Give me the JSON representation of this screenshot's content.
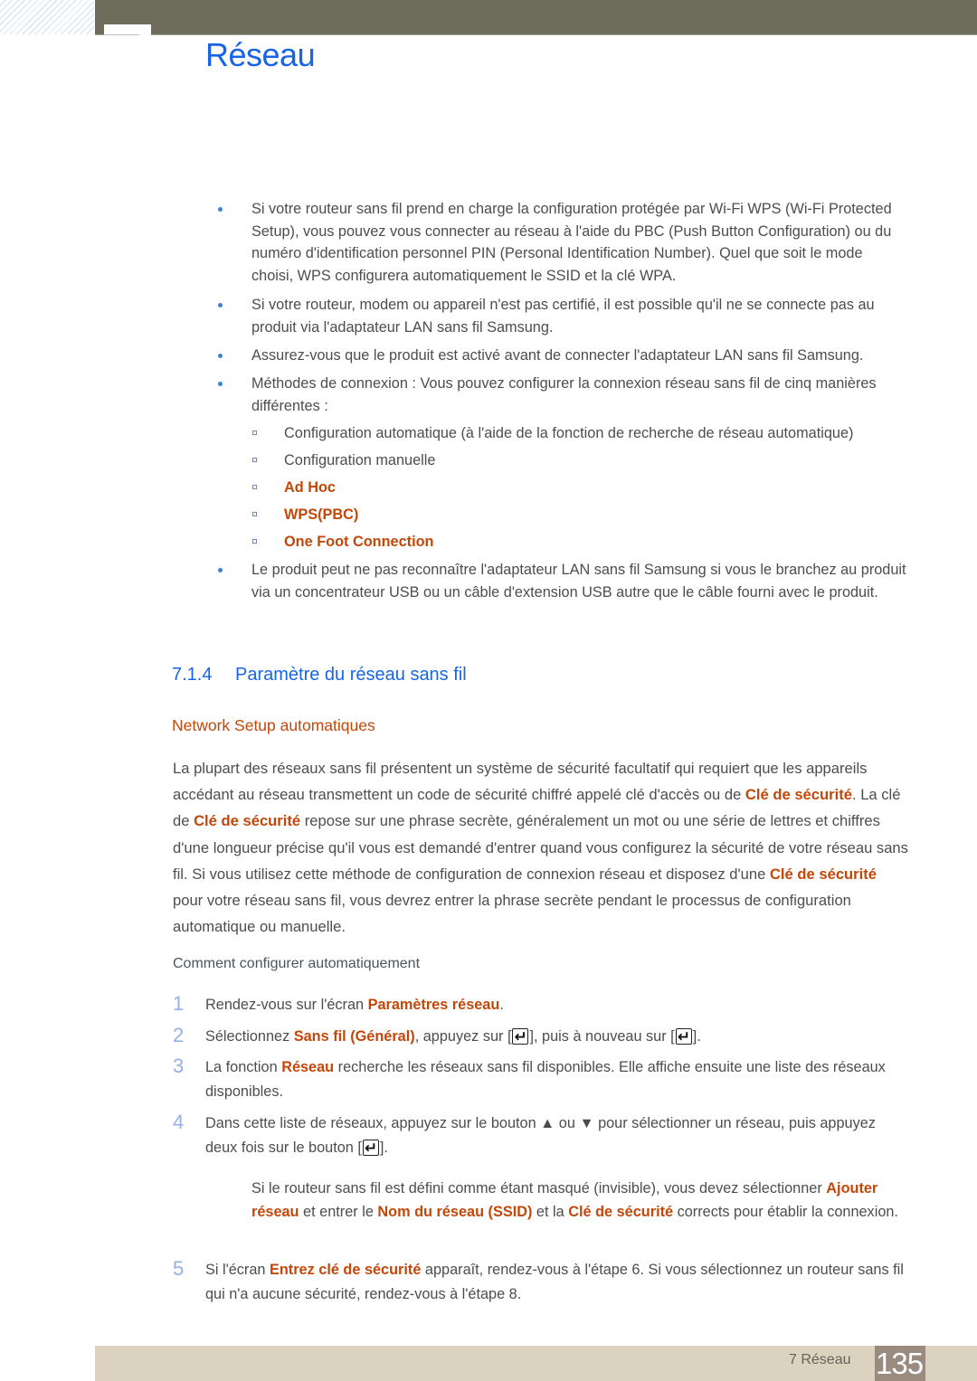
{
  "header": {
    "chapter_title": "Réseau"
  },
  "bullets": [
    "Si votre routeur sans fil prend en charge la configuration protégée par Wi-Fi WPS (Wi-Fi Protected Setup), vous pouvez vous connecter au réseau à l'aide du PBC (Push Button Configuration) ou du numéro d'identification personnel PIN (Personal Identification Number). Quel que soit le mode choisi, WPS configurera automatiquement le SSID et la clé WPA.",
    "Si votre routeur, modem ou appareil n'est pas certifié, il est possible qu'il ne se connecte pas au produit via l'adaptateur LAN sans fil Samsung.",
    "Assurez-vous que le produit est activé avant de connecter l'adaptateur LAN sans fil Samsung.",
    "Méthodes de connexion : Vous pouvez configurer la connexion réseau sans fil de cinq manières différentes :",
    "Le produit peut ne pas reconnaître l'adaptateur LAN sans fil Samsung si vous le branchez au produit via un concentrateur USB ou un câble d'extension USB autre que le câble fourni avec le produit."
  ],
  "connection_methods": [
    {
      "label": "Configuration automatique (à l'aide de la fonction de recherche de réseau automatique)",
      "highlight": false
    },
    {
      "label": "Configuration manuelle",
      "highlight": false
    },
    {
      "label": "Ad Hoc",
      "highlight": true
    },
    {
      "label": "WPS(PBC)",
      "highlight": true
    },
    {
      "label": "One Foot Connection",
      "highlight": true
    }
  ],
  "section": {
    "number": "7.1.4",
    "title": "Paramètre du réseau sans fil"
  },
  "subsection": {
    "title": "Network Setup automatiques"
  },
  "intro": {
    "p1": "La plupart des réseaux sans fil présentent un système de sécurité facultatif qui requiert que les appareils accédant au réseau transmettent un code de sécurité chiffré appelé clé d'accès ou de ",
    "key1": "Clé de sécurité",
    "p2": ". La clé de ",
    "key2": "Clé de sécurité",
    "p3": " repose sur une phrase secrète, généralement un mot ou une série de lettres et chiffres d'une longueur précise qu'il vous est demandé d'entrer quand vous configurez la sécurité de votre réseau sans fil. Si vous utilisez cette méthode de configuration de connexion réseau et disposez d'une ",
    "key3": "Clé de sécurité",
    "p4": " pour votre réseau sans fil, vous devrez entrer la phrase secrète pendant le processus de configuration automatique ou manuelle."
  },
  "howto": {
    "title": "Comment configurer automatiquement"
  },
  "steps": [
    {
      "num": "1",
      "t1": "Rendez-vous sur l'écran ",
      "h1": "Paramètres réseau",
      "t2": "."
    },
    {
      "num": "2",
      "t1": "Sélectionnez ",
      "h1": "Sans fil (Général)",
      "t2": ", appuyez sur [",
      "t3": "], puis à nouveau sur [",
      "t4": "]."
    },
    {
      "num": "3",
      "t1": "La fonction ",
      "h1": "Réseau",
      "t2": " recherche les réseaux sans fil disponibles. Elle affiche ensuite une liste des réseaux disponibles."
    },
    {
      "num": "4",
      "t1": "Dans cette liste de réseaux, appuyez sur le bouton ▲ ou ▼ pour sélectionner un réseau, puis appuyez deux fois sur le bouton [",
      "t2": "]."
    },
    {
      "num": "5",
      "t1": "Si l'écran ",
      "h1": "Entrez clé de sécurité",
      "t2": " apparaît, rendez-vous à l'étape 6. Si vous sélectionnez un routeur sans fil qui n'a aucune sécurité, rendez-vous à l'étape 8."
    }
  ],
  "note": {
    "t1": "Si le routeur sans fil est défini comme étant masqué (invisible), vous devez sélectionner ",
    "h1": "Ajouter réseau",
    "t2": " et entrer le ",
    "h2": "Nom du réseau (SSID)",
    "t3": " et la ",
    "h3": "Clé de sécurité",
    "t4": " corrects pour établir la connexion."
  },
  "icons": {
    "enter_key": "enter-key-icon",
    "bullet": "bullet-dot-icon",
    "sub_bullet": "square-bullet-icon"
  },
  "footer": {
    "chapter_label": "7 Réseau",
    "page_number": "135"
  },
  "colors": {
    "title_blue": "#1765e6",
    "highlight_orange": "#c4470a",
    "header_bar": "#6e6c5a",
    "footer_bar": "#dbd3c0",
    "page_number_bg": "#9a8b80",
    "step_number": "#93b1e6"
  }
}
